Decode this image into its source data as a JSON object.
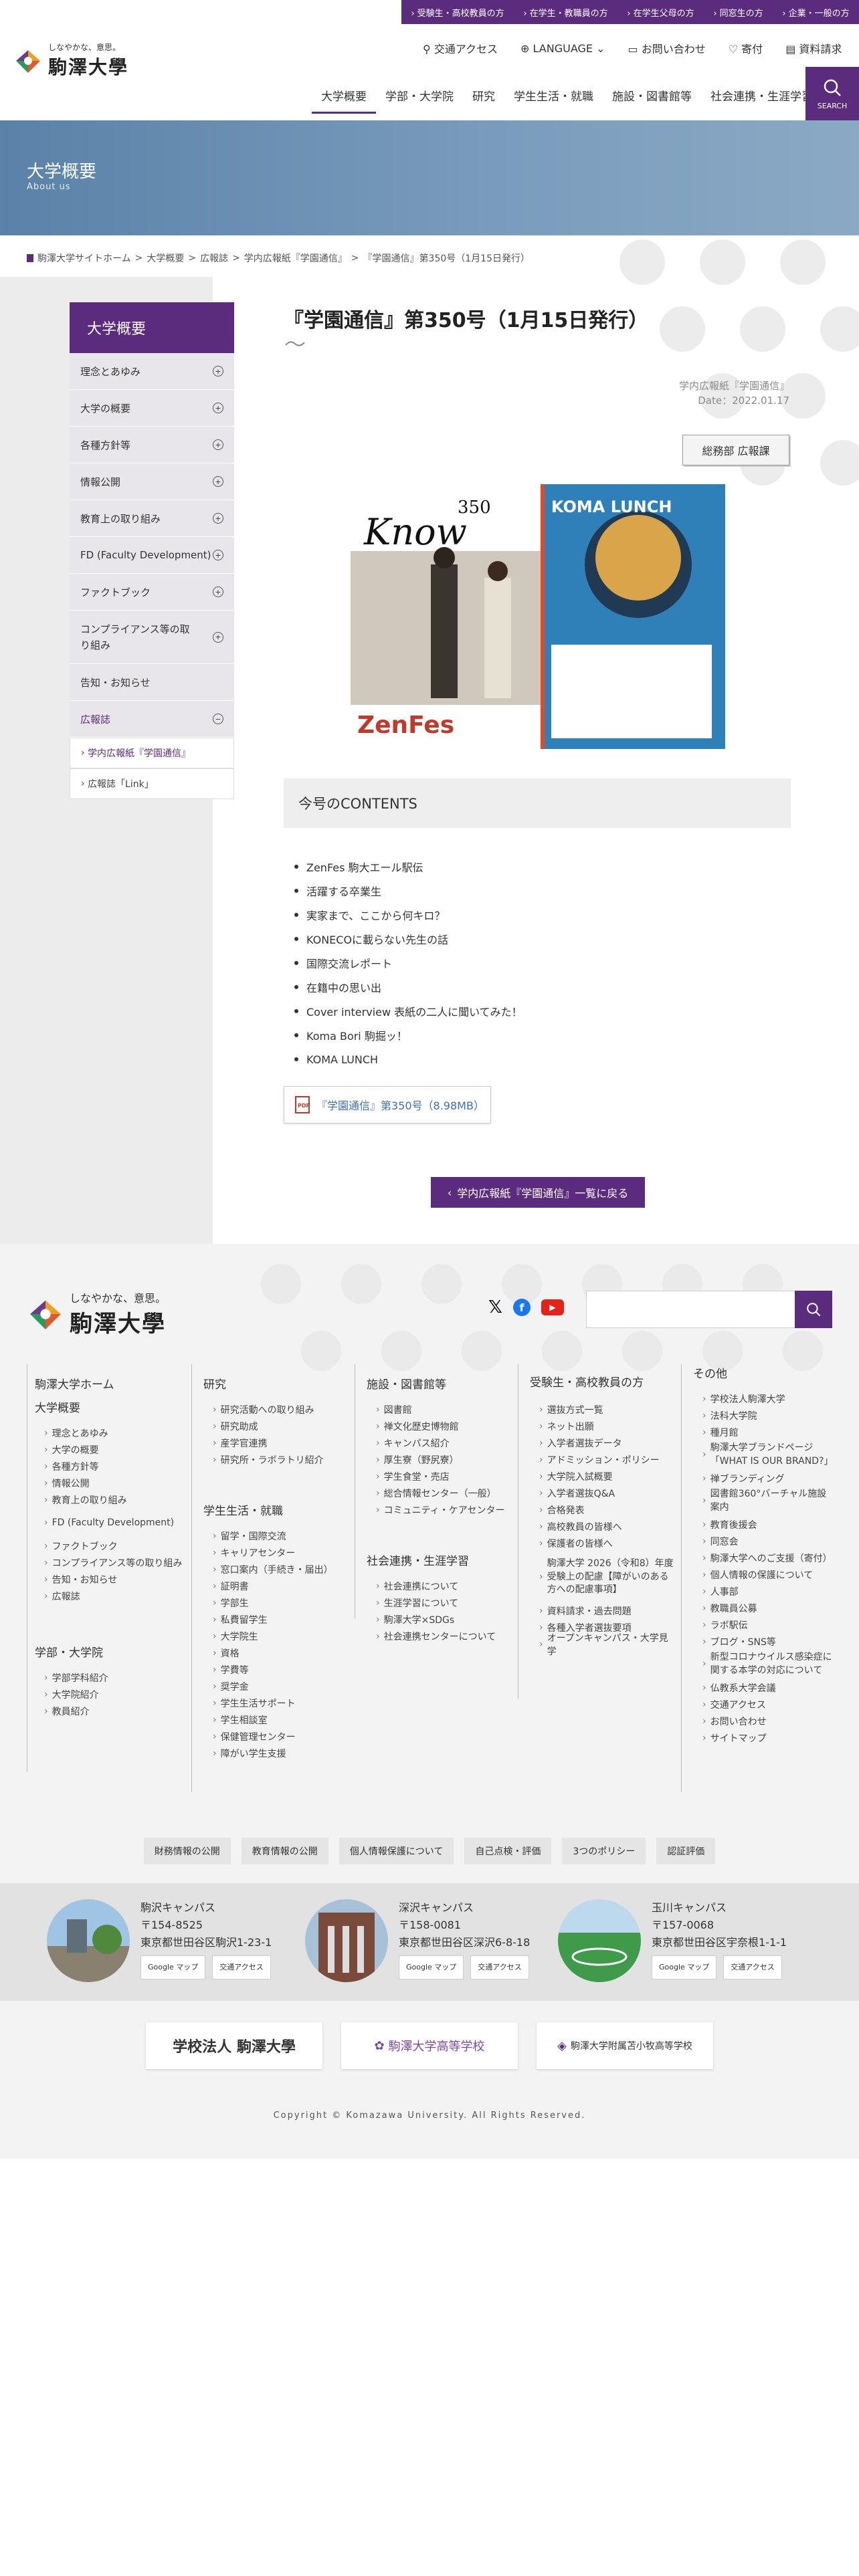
{
  "topbar": {
    "links": [
      "受験生・高校教員の方",
      "在学生・教職員の方",
      "在学生父母の方",
      "同窓生の方",
      "企業・一般の方"
    ]
  },
  "header": {
    "logo_sub": "しなやかな、意思。",
    "logo_main": "駒澤大學",
    "util": {
      "access": "交通アクセス",
      "language": "LANGUAGE",
      "contact": "お問い合わせ",
      "donate": "寄付",
      "request": "資料請求"
    },
    "nav": [
      "大学概要",
      "学部・大学院",
      "研究",
      "学生生活・就職",
      "施設・図書館等",
      "社会連携・生涯学習"
    ],
    "search_label": "SEARCH"
  },
  "hero": {
    "title": "大学概要",
    "subtitle": "About us"
  },
  "breadcrumb": [
    "駒澤大学サイトホーム",
    "大学概要",
    "広報誌",
    "学内広報紙『学園通信』",
    "『学園通信』第350号（1月15日発行）"
  ],
  "sidenav": {
    "title": "大学概要",
    "items": [
      "理念とあゆみ",
      "大学の概要",
      "各種方針等",
      "情報公開",
      "教育上の取り組み",
      "FD (Faculty Development)",
      "ファクトブック",
      "コンプライアンス等の取り組み",
      "告知・お知らせ",
      "広報誌"
    ],
    "sub": [
      "学内広報紙『学園通信』",
      "広報誌「Link」"
    ]
  },
  "article": {
    "title": "『学園通信』第350号（1月15日発行）",
    "category": "学内広報紙『学園通信』",
    "date": "Date：2022.01.17",
    "dept": "総務部 広報課",
    "cover": {
      "number": "350",
      "know": "Know",
      "zenfes": "ZenFes",
      "koma": "KOMA LUNCH"
    },
    "contents_title": "今号のCONTENTS",
    "contents": [
      "ZenFes 駒大エール駅伝",
      "活躍する卒業生",
      "実家まで、ここから何キロ？",
      "KONECOに載らない先生の話",
      "国際交流レポート",
      "在籍中の思い出",
      "Cover interview 表紙の二人に聞いてみた！",
      "Koma Bori 駒掘ッ！",
      "KOMA LUNCH"
    ],
    "pdf_label": "『学園通信』第350号（8.98MB）",
    "back_label": "学内広報紙『学園通信』一覧に戻る"
  },
  "footer": {
    "logo_sub": "しなやかな、意思。",
    "logo_main": "駒澤大學",
    "col1": {
      "home": "駒澤大学ホーム",
      "h1": "大学概要",
      "items1": [
        "理念とあゆみ",
        "大学の概要",
        "各種方針等",
        "情報公開",
        "教育上の取り組み",
        "FD (Faculty Development)",
        "ファクトブック",
        "コンプライアンス等の取り組み",
        "告知・お知らせ",
        "広報誌"
      ],
      "h2": "学部・大学院",
      "items2": [
        "学部学科紹介",
        "大学院紹介",
        "教員紹介"
      ]
    },
    "col2": {
      "h1": "研究",
      "items1": [
        "研究活動への取り組み",
        "研究助成",
        "産学官連携",
        "研究所・ラボラトリ紹介"
      ],
      "h2": "学生生活・就職",
      "items2": [
        "留学・国際交流",
        "キャリアセンター",
        "窓口案内（手続き・届出）",
        "証明書",
        "学部生",
        "私費留学生",
        "大学院生",
        "資格",
        "学費等",
        "奨学金",
        "学生生活サポート",
        "学生相談室",
        "保健管理センター",
        "障がい学生支援"
      ]
    },
    "col3": {
      "h1": "施設・図書館等",
      "items1": [
        "図書館",
        "禅文化歴史博物館",
        "キャンパス紹介",
        "厚生寮（野尻寮）",
        "学生食堂・売店",
        "総合情報センター（一般）",
        "コミュニティ・ケアセンター"
      ],
      "h2": "社会連携・生涯学習",
      "items2": [
        "社会連携について",
        "生涯学習について",
        "駒澤大学×SDGs",
        "社会連携センターについて"
      ]
    },
    "col4": {
      "h1": "受験生・高校教員の方",
      "items1": [
        "選抜方式一覧",
        "ネット出願",
        "入学者選抜データ",
        "アドミッション・ポリシー",
        "大学院入試概要",
        "入学者選抜Q&A",
        "合格発表",
        "高校教員の皆様へ",
        "保護者の皆様へ",
        "駒澤大学 2026（令和8）年度受験上の配慮【障がいのある方への配慮事項】",
        "資料請求・過去問題",
        "各種入学者選抜要項",
        "オープンキャンパス・大学見学"
      ]
    },
    "col5": {
      "h1": "その他",
      "items1": [
        "学校法人駒澤大学",
        "法科大学院",
        "種月館",
        "駒澤大学ブランドページ「WHAT IS OUR BRAND?」",
        "禅ブランディング",
        "図書館360°バーチャル施設案内",
        "教育後援会",
        "同窓会",
        "駒澤大学へのご支援（寄付）",
        "個人情報の保護について",
        "人事部",
        "教職員公募",
        "ラボ駅伝",
        "ブログ・SNS等",
        "新型コロナウイルス感染症に関する本学の対応について",
        "仏教系大学会議",
        "交通アクセス",
        "お問い合わせ",
        "サイトマップ"
      ]
    },
    "buttons": [
      "財務情報の公開",
      "教育情報の公開",
      "個人情報保護について",
      "自己点検・評価",
      "3つのポリシー",
      "認証評価"
    ],
    "campuses": [
      {
        "name": "駒沢キャンパス",
        "zip": "〒154-8525",
        "addr": "東京都世田谷区駒沢1-23-1",
        "map": "Google マップ",
        "access": "交通アクセス"
      },
      {
        "name": "深沢キャンパス",
        "zip": "〒158-0081",
        "addr": "東京都世田谷区深沢6-8-18",
        "map": "Google マップ",
        "access": "交通アクセス"
      },
      {
        "name": "玉川キャンパス",
        "zip": "〒157-0068",
        "addr": "東京都世田谷区宇奈根1-1-1",
        "map": "Google マップ",
        "access": "交通アクセス"
      }
    ],
    "bottom_logos": [
      "学校法人 駒澤大學",
      "駒澤大学高等学校",
      "駒澤大学附属苫小牧高等学校"
    ],
    "copyright": "Copyright © Komazawa University. All Rights Reserved."
  },
  "colors": {
    "brand": "#5b2b7e",
    "hero": "#6f93b6"
  }
}
